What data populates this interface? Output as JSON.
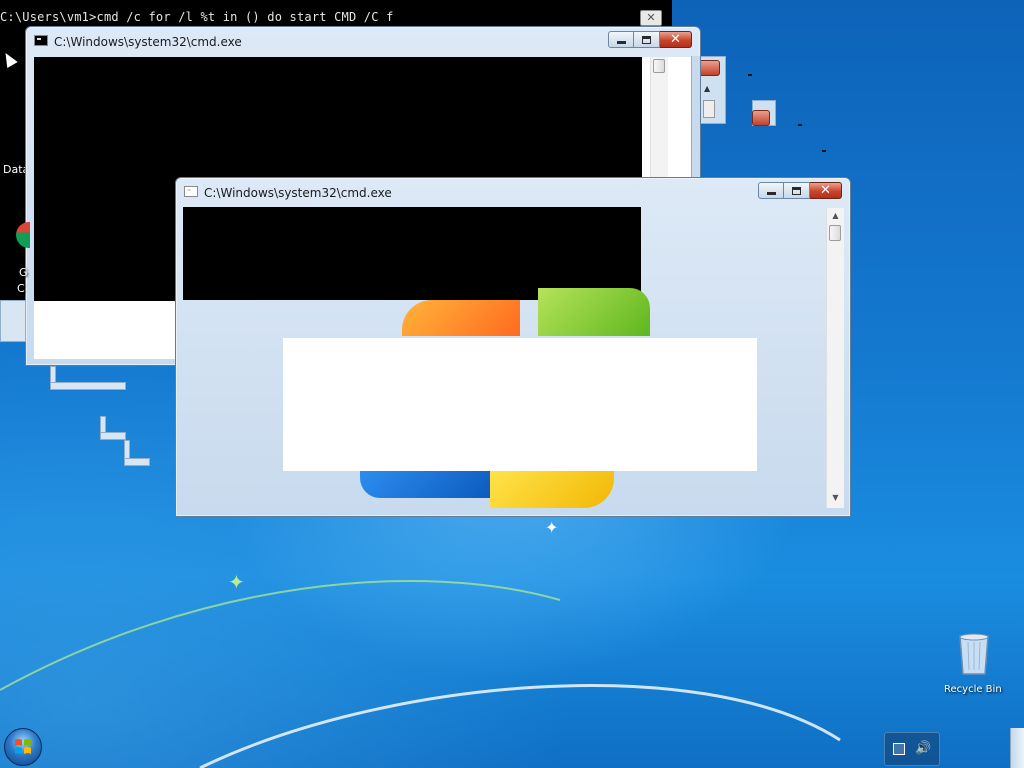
{
  "background_console": {
    "command_line": "C:\\Users\\vm1>cmd /c for /l %t in () do start CMD /C f"
  },
  "windows": [
    {
      "title": "C:\\Windows\\system32\\cmd.exe",
      "minimize_label": "",
      "maximize_label": "",
      "close_label": "✕"
    },
    {
      "title": "C:\\Windows\\system32\\cmd.exe",
      "minimize_label": "",
      "maximize_label": "",
      "close_label": "✕"
    }
  ],
  "scrollbar": {
    "up": "▲",
    "down": "▼"
  },
  "desktop": {
    "icon_label_data": "Data",
    "icon_label_g": "G",
    "icon_label_c": "C",
    "recycle_bin_label": "Recycle Bin"
  },
  "tray": {
    "network_icon": "network-icon",
    "volume_icon": "volume-icon"
  },
  "colors": {
    "close_red": "#c8452c",
    "titlebar": "#c8daee",
    "desktop": "#1478cf"
  }
}
